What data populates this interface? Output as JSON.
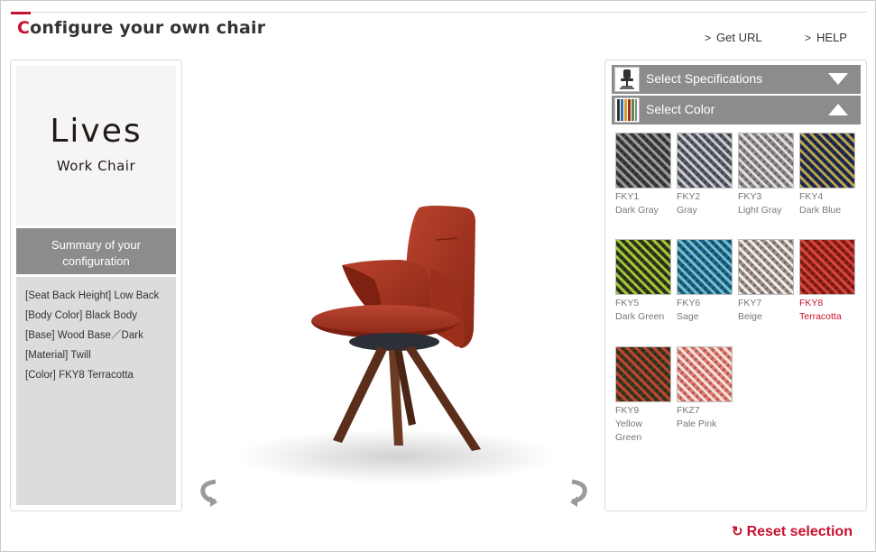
{
  "header": {
    "title_first_letter": "C",
    "title_rest": "onfigure your own chair",
    "links": [
      {
        "label": "Get URL",
        "chevron": ">"
      },
      {
        "label": "HELP",
        "chevron": ">"
      }
    ]
  },
  "product": {
    "name": "Lives",
    "subtitle": "Work Chair"
  },
  "summary": {
    "heading_line1": "Summary of your",
    "heading_line2": "configuration",
    "items": [
      "[Seat Back Height] Low Back",
      "[Body Color] Black Body",
      "[Base] Wood Base／Dark",
      "[Material] Twill",
      "[Color] FKY8 Terracotta"
    ]
  },
  "accordion": {
    "specifications": {
      "label": "Select Specifications",
      "icon": "chair-icon",
      "state": "collapsed"
    },
    "color": {
      "label": "Select Color",
      "icon": "fabric-strip-icon",
      "state": "expanded"
    }
  },
  "swatches": [
    {
      "code": "FKY1",
      "name": "Dark Gray",
      "base": "#3a3a3a",
      "weave": "#9a9a9a",
      "selected": false
    },
    {
      "code": "FKY2",
      "name": "Gray",
      "base": "#55575e",
      "weave": "#c9cbd3",
      "selected": false
    },
    {
      "code": "FKY3",
      "name": "Light Gray",
      "base": "#8a8584",
      "weave": "#e2dedd",
      "selected": false
    },
    {
      "code": "FKY4",
      "name": "Dark Blue",
      "base": "#1c2a55",
      "weave": "#b9a24a",
      "selected": false
    },
    {
      "code": "FKY5",
      "name": "Dark Green",
      "base": "#2b3a1c",
      "weave": "#a9c23a",
      "selected": false
    },
    {
      "code": "FKY6",
      "name": "Sage",
      "base": "#1e5f8a",
      "weave": "#6fc0c8",
      "selected": false
    },
    {
      "code": "FKY7",
      "name": "Beige",
      "base": "#9a8d86",
      "weave": "#f1ece8",
      "selected": false
    },
    {
      "code": "FKY8",
      "name": "Terracotta",
      "base": "#8e1f1a",
      "weave": "#d8463a",
      "selected": true
    },
    {
      "code": "FKY9",
      "name": "Yellow Green",
      "base": "#3d3a22",
      "weave": "#c2452f",
      "selected": false
    },
    {
      "code": "FKZ7",
      "name": "Pale Pink",
      "base": "#e07a6f",
      "weave": "#fae0dc",
      "selected": false
    }
  ],
  "reset": {
    "label": "Reset selection"
  },
  "colors": {
    "accent": "#c8102e",
    "panel_gray": "#8c8c8c",
    "summary_bg": "#dcdcdc",
    "chair_fabric": "#a8331f",
    "chair_wood": "#5a2e1a"
  }
}
